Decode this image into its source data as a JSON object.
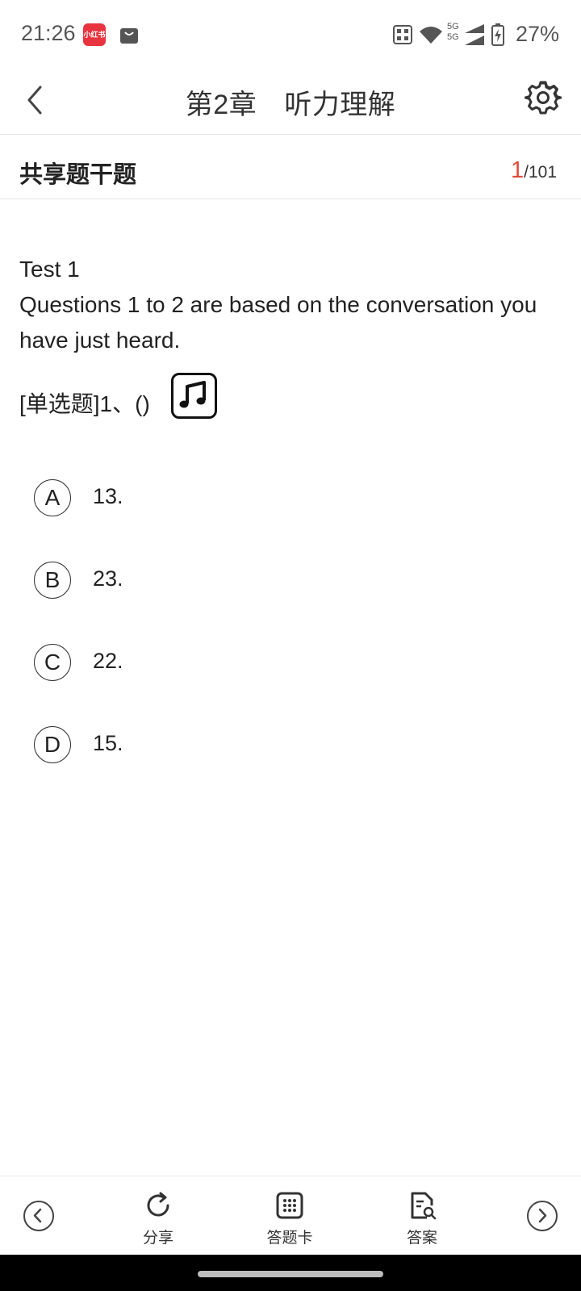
{
  "status_bar": {
    "time": "21:26",
    "app_badge": "小红书",
    "network": "5G",
    "battery": "27%"
  },
  "header": {
    "title_part1": "第2章",
    "title_part2": "听力理解"
  },
  "section": {
    "title": "共享题干题",
    "current": "1",
    "total": "/101"
  },
  "question": {
    "passage_title": "Test 1",
    "passage_body": "Questions 1 to 2 are based on the conversation you have just heard.",
    "type_label": "[单选题]1、()"
  },
  "options": [
    {
      "letter": "A",
      "text": "13."
    },
    {
      "letter": "B",
      "text": "23."
    },
    {
      "letter": "C",
      "text": "22."
    },
    {
      "letter": "D",
      "text": "15."
    }
  ],
  "toolbar": {
    "share": "分享",
    "answer_card": "答题卡",
    "answer": "答案"
  },
  "icons": {
    "back": "chevron-left-icon",
    "settings": "gear-icon",
    "audio": "music-note-icon",
    "prev": "circle-chevron-left-icon",
    "next": "circle-chevron-right-icon"
  }
}
